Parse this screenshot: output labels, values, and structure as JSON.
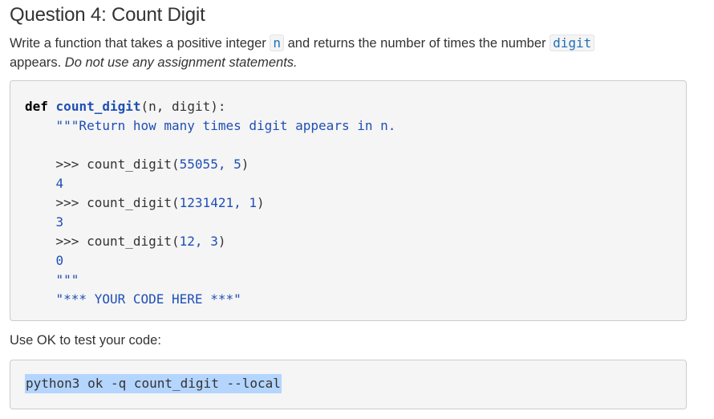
{
  "question": {
    "title": "Question 4: Count Digit",
    "desc_part1": "Write a function that takes a positive integer ",
    "desc_code_n": "n",
    "desc_part2": " and returns the number of times the number ",
    "desc_code_digit": "digit",
    "desc_part3": " appears. ",
    "desc_emphasis": "Do not use any assignment statements."
  },
  "code": {
    "def_keyword": "def",
    "func_name": "count_digit",
    "signature_rest": "(n, digit):",
    "docstring_line": "\"\"\"Return how many times digit appears in n.",
    "examples": [
      {
        "prompt": ">>> ",
        "call": "count_digit(",
        "args": "55055, 5",
        "close": ")",
        "result": "4"
      },
      {
        "prompt": ">>> ",
        "call": "count_digit(",
        "args": "1231421, 1",
        "close": ")",
        "result": "3"
      },
      {
        "prompt": ">>> ",
        "call": "count_digit(",
        "args": "12, 3",
        "close": ")",
        "result": "0"
      }
    ],
    "docstring_end": "\"\"\"",
    "placeholder": "\"*** YOUR CODE HERE ***\""
  },
  "test": {
    "label": "Use OK to test your code:",
    "command": "python3 ok -q count_digit --local"
  }
}
